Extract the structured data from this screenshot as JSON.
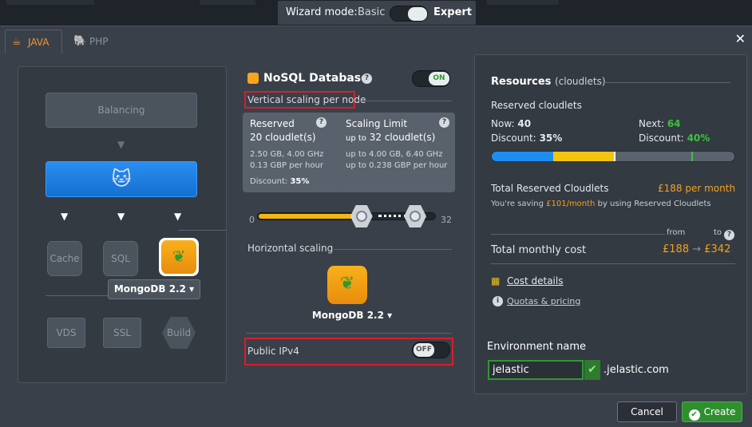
{
  "wizard": {
    "label": "Wizard mode:",
    "basic": "Basic",
    "expert": "Expert"
  },
  "tabs": [
    {
      "label": "JAVA"
    },
    {
      "label": "PHP"
    }
  ],
  "topology": {
    "balancing": "Balancing",
    "cache": "Cache",
    "sql": "SQL",
    "nosql_selected": "MongoDB 2.2",
    "vds": "VDS",
    "ssl": "SSL",
    "build": "Build"
  },
  "nosql": {
    "title": "NoSQL Database",
    "toggle": "ON",
    "vertical_label": "Vertical scaling per node",
    "reserved": {
      "title": "Reserved",
      "cloudlets": "20 cloudlet(s)",
      "specs": "2.50 GB, 4.00 GHz",
      "price": "0.13 GBP per hour",
      "discount_label": "Discount:",
      "discount_value": "35%"
    },
    "limit": {
      "title": "Scaling Limit",
      "cloudlets_prefix": "up to",
      "cloudlets": "32 cloudlet(s)",
      "specs": "up to 4.00 GB, 6.40 GHz",
      "price": "up to 0.238 GBP per hour"
    },
    "slider_min": "0",
    "slider_max": "32",
    "slider_reserved": 20,
    "slider_limit": 32,
    "horizontal_label": "Horizontal scaling",
    "node_label": "MongoDB 2.2",
    "public_ipv4": "Public IPv4",
    "ipv4_toggle": "OFF"
  },
  "resources": {
    "title": "Resources",
    "title_suffix": "(cloudlets)",
    "reserved_label": "Reserved cloudlets",
    "now_label": "Now:",
    "now_value": "40",
    "next_label": "Next:",
    "next_value": "64",
    "discount_label": "Discount:",
    "discount_now": "35%",
    "discount_next": "40%",
    "total_reserved_label": "Total Reserved Cloudlets",
    "total_reserved_value": "£188 per month",
    "saving_prefix": "You're saving",
    "saving_value": "£101/month",
    "saving_suffix": "by using Reserved Cloudlets",
    "from_label": "from",
    "to_label": "to",
    "monthly_label": "Total monthly cost",
    "monthly_from": "£188",
    "monthly_to": "£342",
    "cost_details": "Cost details",
    "quotas": "Quotas & pricing"
  },
  "env": {
    "label": "Environment name",
    "value": "jelastic",
    "domain": ".jelastic.com"
  },
  "buttons": {
    "cancel": "Cancel",
    "create": "Create"
  }
}
